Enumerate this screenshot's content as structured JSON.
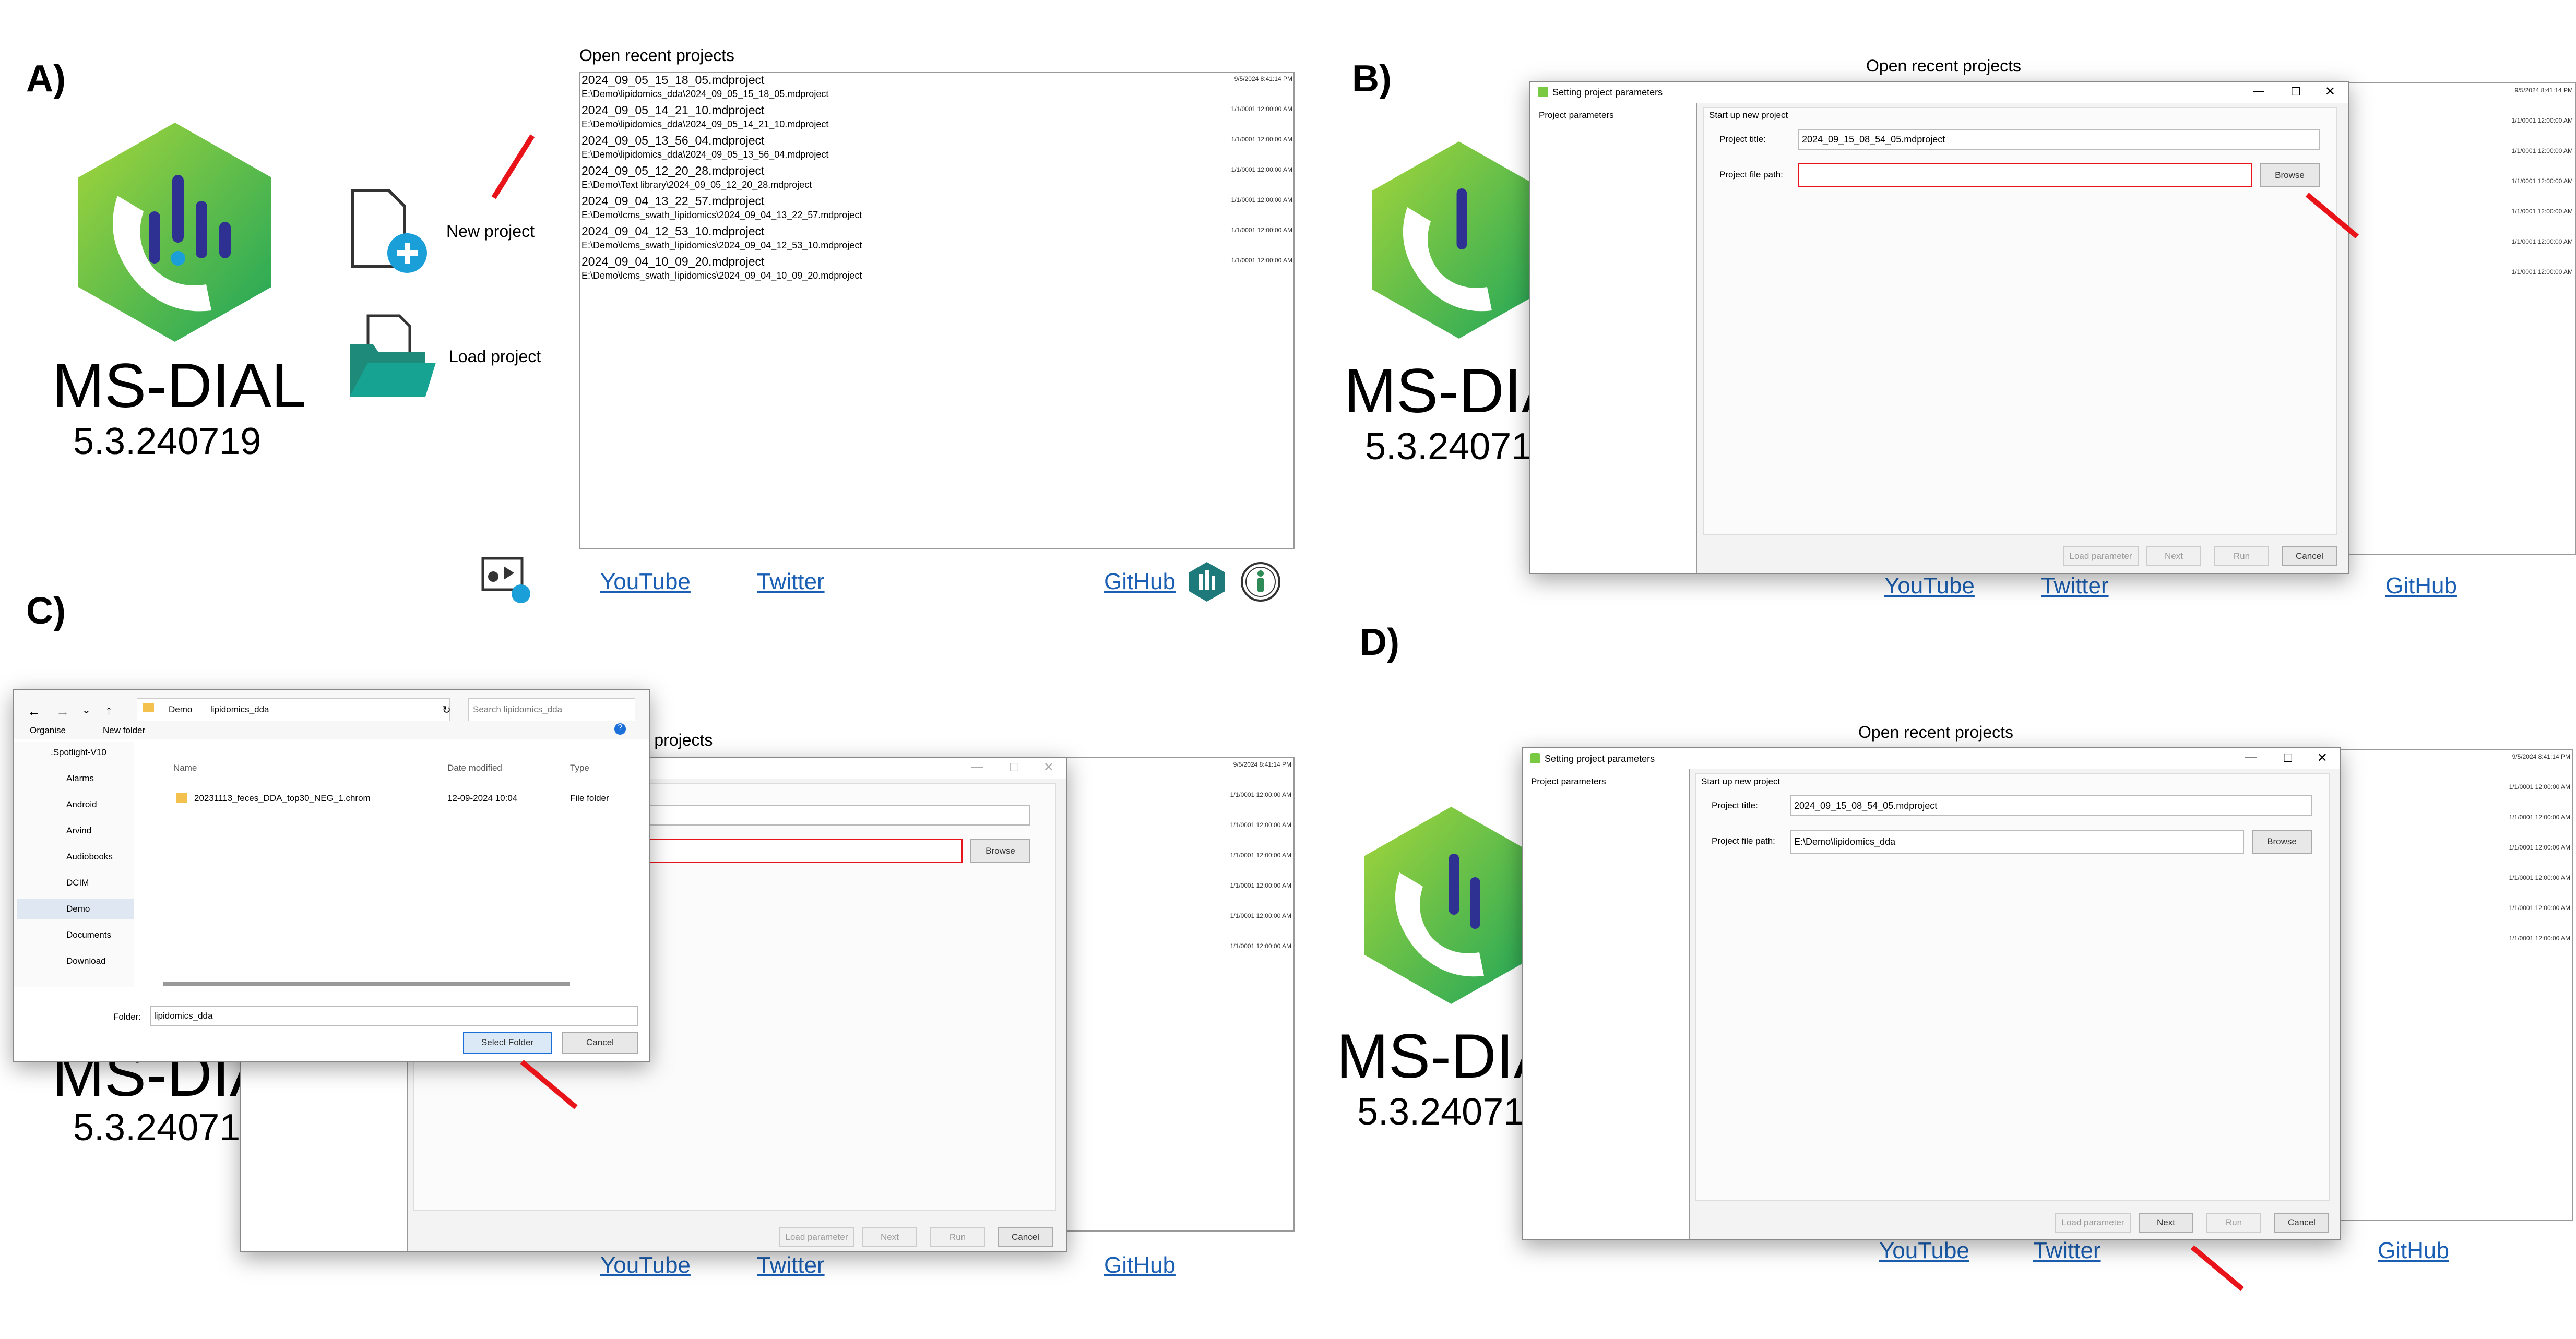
{
  "panel_labels": [
    "A)",
    "B)",
    "C)",
    "D)"
  ],
  "app": {
    "name": "MS-DIAL",
    "version": "5.3.240719",
    "version_cropped": "5.3.24071",
    "name_cropped": "MS-DIA"
  },
  "start": {
    "new_project": "New project",
    "load_project": "Load project"
  },
  "recent": {
    "title": "Open recent projects",
    "items": [
      {
        "name": "2024_09_05_15_18_05.mdproject",
        "path": "E:\\Demo\\lipidomics_dda\\2024_09_05_15_18_05.mdproject",
        "date": "9/5/2024 8:41:14 PM"
      },
      {
        "name": "2024_09_05_14_21_10.mdproject",
        "path": "E:\\Demo\\lipidomics_dda\\2024_09_05_14_21_10.mdproject",
        "date": "1/1/0001 12:00:00 AM"
      },
      {
        "name": "2024_09_05_13_56_04.mdproject",
        "path": "E:\\Demo\\lipidomics_dda\\2024_09_05_13_56_04.mdproject",
        "date": "1/1/0001 12:00:00 AM"
      },
      {
        "name": "2024_09_05_12_20_28.mdproject",
        "path": "E:\\Demo\\Text library\\2024_09_05_12_20_28.mdproject",
        "date": "1/1/0001 12:00:00 AM"
      },
      {
        "name": "2024_09_04_13_22_57.mdproject",
        "path": "E:\\Demo\\lcms_swath_lipidomics\\2024_09_04_13_22_57.mdproject",
        "date": "1/1/0001 12:00:00 AM"
      },
      {
        "name": "2024_09_04_12_53_10.mdproject",
        "path": "E:\\Demo\\lcms_swath_lipidomics\\2024_09_04_12_53_10.mdproject",
        "date": "1/1/0001 12:00:00 AM"
      },
      {
        "name": "2024_09_04_10_09_20.mdproject",
        "path": "E:\\Demo\\lcms_swath_lipidomics\\2024_09_04_10_09_20.mdproject",
        "date": "1/1/0001 12:00:00 AM"
      }
    ]
  },
  "links": {
    "youtube": "YouTube",
    "twitter": "Twitter",
    "github": "GitHub"
  },
  "dialog": {
    "title": "Setting project parameters",
    "sidebar_item": "Project parameters",
    "group": "Start up new project",
    "title_label": "Project title:",
    "title_value": "2024_09_15_08_54_05.mdproject",
    "path_label": "Project file path:",
    "path_value_empty": "",
    "path_value_filled": "E:\\Demo\\lipidomics_dda",
    "browse": "Browse",
    "load_parameter": "Load parameter",
    "next": "Next",
    "run": "Run",
    "cancel": "Cancel",
    "title_fragment": "ect"
  },
  "folder_dialog": {
    "breadcrumb": [
      "Demo",
      "lipidomics_dda"
    ],
    "search_placeholder": "Search lipidomics_dda",
    "organise": "Organise",
    "new_folder": "New folder",
    "col_name": "Name",
    "col_date": "Date modified",
    "col_type": "Type",
    "tree": [
      ".Spotlight-V10",
      "Alarms",
      "Android",
      "Arvind",
      "Audiobooks",
      "DCIM",
      "Demo",
      "Documents",
      "Download"
    ],
    "file": {
      "name": "20231113_feces_DDA_top30_NEG_1.chrom",
      "date": "12-09-2024 10:04",
      "type": "File folder"
    },
    "folder_label": "Folder:",
    "folder_value": "lipidomics_dda",
    "select_folder": "Select Folder",
    "cancel": "Cancel"
  },
  "c_recent_title_fragment": "ent projects",
  "colors": {
    "accent_red": "#e8141a",
    "link_blue": "#1a5fb4",
    "logo_green": "#7ac943",
    "logo_purple": "#2e3192"
  }
}
